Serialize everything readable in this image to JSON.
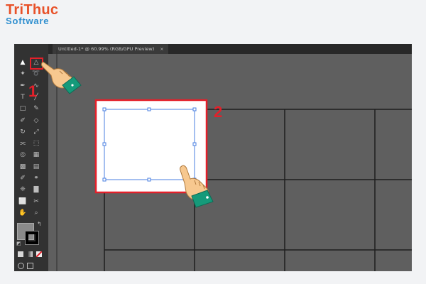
{
  "brand": {
    "line1": "TriThuc",
    "line2": "Software"
  },
  "document_tab": {
    "title": "Untitled-1* @ 60.99% (RGB/GPU Preview)",
    "close_glyph": "×"
  },
  "tools": [
    {
      "name": "selection-tool",
      "glyph": "▲",
      "selected": true
    },
    {
      "name": "direct-selection-tool",
      "glyph": "△"
    },
    {
      "name": "magic-wand-tool",
      "glyph": "✦"
    },
    {
      "name": "lasso-tool",
      "glyph": "➰"
    },
    {
      "name": "pen-tool",
      "glyph": "✒"
    },
    {
      "name": "curvature-tool",
      "glyph": "∿"
    },
    {
      "name": "type-tool",
      "glyph": "T"
    },
    {
      "name": "line-tool",
      "glyph": "╱"
    },
    {
      "name": "rectangle-tool",
      "glyph": "□"
    },
    {
      "name": "paintbrush-tool",
      "glyph": "✎"
    },
    {
      "name": "shaper-tool",
      "glyph": "✐"
    },
    {
      "name": "eraser-tool",
      "glyph": "◇"
    },
    {
      "name": "rotate-tool",
      "glyph": "↻"
    },
    {
      "name": "scale-tool",
      "glyph": "⤢"
    },
    {
      "name": "width-tool",
      "glyph": "⫘"
    },
    {
      "name": "free-transform-tool",
      "glyph": "⬚"
    },
    {
      "name": "shape-builder-tool",
      "glyph": "◎"
    },
    {
      "name": "perspective-grid-tool",
      "glyph": "▦"
    },
    {
      "name": "mesh-tool",
      "glyph": "▩"
    },
    {
      "name": "gradient-tool",
      "glyph": "▤"
    },
    {
      "name": "eyedropper-tool",
      "glyph": "✐"
    },
    {
      "name": "blend-tool",
      "glyph": "⚭"
    },
    {
      "name": "symbol-sprayer-tool",
      "glyph": "❈"
    },
    {
      "name": "column-graph-tool",
      "glyph": "▇"
    },
    {
      "name": "artboard-tool",
      "glyph": "⬜"
    },
    {
      "name": "slice-tool",
      "glyph": "✂"
    },
    {
      "name": "hand-tool",
      "glyph": "✋"
    },
    {
      "name": "zoom-tool",
      "glyph": "⌕"
    }
  ],
  "colors": {
    "fill": "#8a8a8a",
    "stroke": "#000000",
    "highlight": "#e4202a",
    "selection": "#4a7fe0",
    "hand_skin": "#f7c88f",
    "sleeve": "#159a7a"
  },
  "annotations": {
    "step1": "1",
    "step2": "2"
  }
}
